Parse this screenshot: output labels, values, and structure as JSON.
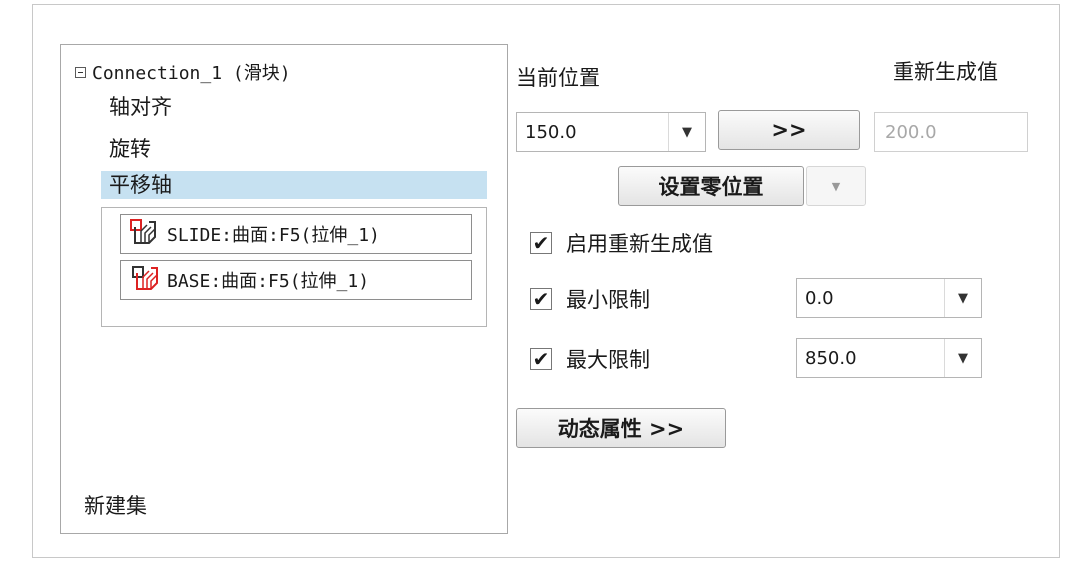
{
  "tree": {
    "root_label": "Connection_1 (滑块)",
    "items": [
      "轴对齐",
      "旋转"
    ],
    "selected_item": "平移轴",
    "references": [
      {
        "label": "SLIDE:曲面:F5(拉伸_1)",
        "icon": "surface-reference-icon"
      },
      {
        "label": "BASE:曲面:F5(拉伸_1)",
        "icon": "surface-reference-icon"
      }
    ],
    "new_set": "新建集"
  },
  "settings": {
    "current_position_label": "当前位置",
    "regen_value_label": "重新生成值",
    "current_position_value": "150.0",
    "copy_button": ">>",
    "regen_value": "200.0",
    "set_zero_button": "设置零位置",
    "enable_regen_label": "启用重新生成值",
    "enable_regen_checked": true,
    "min_limit_label": "最小限制",
    "min_limit_checked": true,
    "min_limit_value": "0.0",
    "max_limit_label": "最大限制",
    "max_limit_checked": true,
    "max_limit_value": "850.0",
    "dynamic_props_button": "动态属性 >>"
  }
}
